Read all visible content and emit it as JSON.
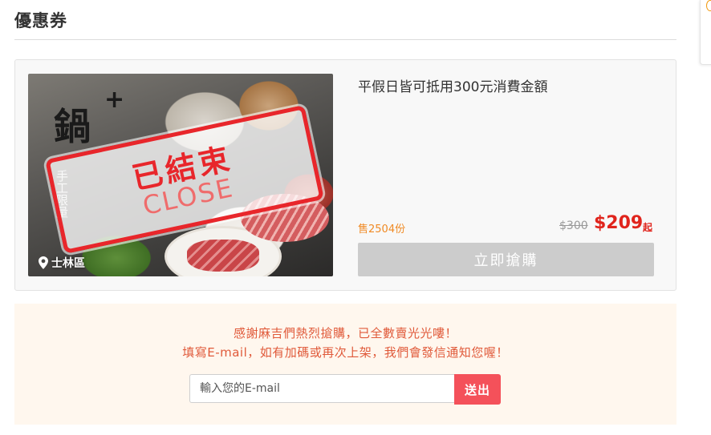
{
  "section": {
    "title": "優惠券"
  },
  "coupon": {
    "title": "平假日皆可抵用300元消費金額",
    "image": {
      "brand_mark": "鍋",
      "brand_plus": "+",
      "side_text": "手工限量",
      "stamp_cn": "已結束",
      "stamp_en": "CLOSE",
      "location": "士林區"
    },
    "sold": "售2504份",
    "original_price": "$300",
    "sale_price": "$209",
    "price_suffix": "起",
    "buy_label": "立即搶購"
  },
  "notify": {
    "line1": "感謝麻吉們熱烈搶購，已全數賣光光嘍！",
    "line2": "填寫E-mail，如有加碼或再次上架，我們會發信通知您喔！",
    "email_placeholder": "輸入您的E-mail",
    "submit_label": "送出"
  },
  "colors": {
    "stamp_red": "#e8262b",
    "price_red": "#e0241c",
    "sold_orange": "#f08a24",
    "submit_red": "#f4515a",
    "notify_bg": "#fff7ee"
  }
}
